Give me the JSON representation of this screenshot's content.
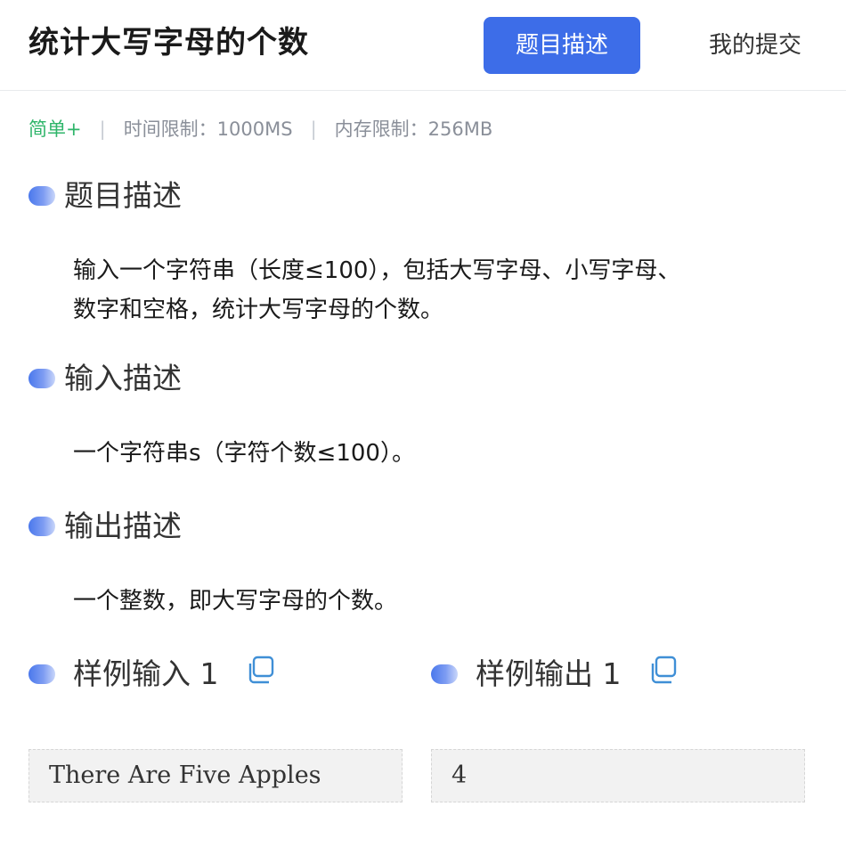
{
  "header": {
    "title": "统计大写字母的个数",
    "tabs": [
      {
        "label": "题目描述",
        "active": true
      },
      {
        "label": "我的提交",
        "active": false
      }
    ],
    "accent_color": "#3d6de8"
  },
  "meta": {
    "difficulty": "简单+",
    "separator": "|",
    "time_limit": "时间限制：1000MS",
    "memory_limit": "内存限制：256MB",
    "difficulty_color": "#2fb56a"
  },
  "sections": {
    "description": {
      "title": "题目描述",
      "lines": [
        "输入一个字符串（长度≤100），包括大写字母、小写字母、",
        "数字和空格，统计大写字母的个数。"
      ]
    },
    "input": {
      "title": "输入描述",
      "lines": [
        "一个字符串s（字符个数≤100）。"
      ]
    },
    "output": {
      "title": "输出描述",
      "lines": [
        "一个整数，即大写字母的个数。"
      ]
    }
  },
  "samples": {
    "input": {
      "title": "样例输入 1",
      "value": "There Are Five Apples",
      "icon": "copy-icon"
    },
    "output": {
      "title": "样例输出 1",
      "value": "4",
      "icon": "copy-icon"
    }
  }
}
